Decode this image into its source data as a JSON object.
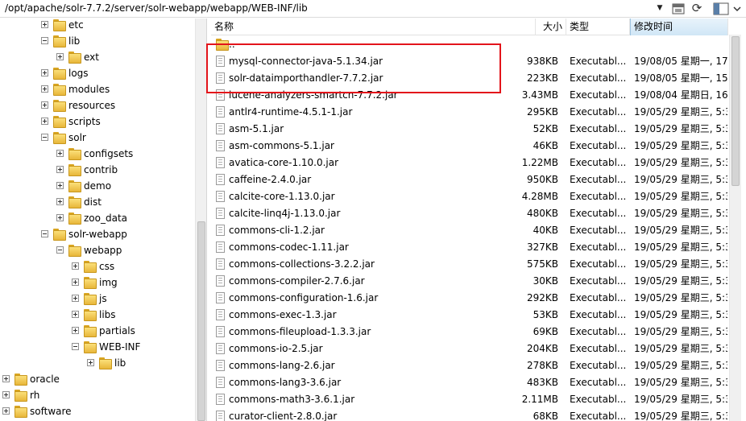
{
  "path": "/opt/apache/solr-7.7.2/server/solr-webapp/webapp/WEB-INF/lib",
  "toolbar": {
    "dropdown_icon": "chevron-down-icon",
    "home_icon": "home-icon",
    "refresh_icon": "refresh-icon",
    "view_icon": "view-toggle-icon"
  },
  "tree": [
    {
      "label": "etc",
      "expander": "plus"
    },
    {
      "label": "lib",
      "expander": "minus"
    },
    {
      "label": "ext",
      "expander": "plus"
    },
    {
      "label": "logs",
      "expander": "plus"
    },
    {
      "label": "modules",
      "expander": "plus"
    },
    {
      "label": "resources",
      "expander": "plus"
    },
    {
      "label": "scripts",
      "expander": "plus"
    },
    {
      "label": "solr",
      "expander": "minus"
    },
    {
      "label": "configsets",
      "expander": "plus"
    },
    {
      "label": "contrib",
      "expander": "plus"
    },
    {
      "label": "demo",
      "expander": "plus"
    },
    {
      "label": "dist",
      "expander": "plus"
    },
    {
      "label": "zoo_data",
      "expander": "plus"
    },
    {
      "label": "solr-webapp",
      "expander": "minus"
    },
    {
      "label": "webapp",
      "expander": "minus"
    },
    {
      "label": "css",
      "expander": "plus"
    },
    {
      "label": "img",
      "expander": "plus"
    },
    {
      "label": "js",
      "expander": "plus"
    },
    {
      "label": "libs",
      "expander": "plus"
    },
    {
      "label": "partials",
      "expander": "plus"
    },
    {
      "label": "WEB-INF",
      "expander": "minus"
    },
    {
      "label": "lib",
      "expander": "plus"
    },
    {
      "label": "oracle",
      "expander": "plus"
    },
    {
      "label": "rh",
      "expander": "plus"
    },
    {
      "label": "software",
      "expander": "plus"
    }
  ],
  "columns": {
    "name": "名称",
    "size": "大小",
    "type": "类型",
    "modified": "修改时间"
  },
  "files": [
    {
      "name": "..",
      "size": "",
      "type": "",
      "modified": "",
      "kind": "folder"
    },
    {
      "name": "mysql-connector-java-5.1.34.jar",
      "size": "938KB",
      "type": "Executabl...",
      "modified": "19/08/05 星期一, 17:",
      "kind": "file"
    },
    {
      "name": "solr-dataimporthandler-7.7.2.jar",
      "size": "223KB",
      "type": "Executabl...",
      "modified": "19/08/05 星期一, 15:",
      "kind": "file"
    },
    {
      "name": "lucene-analyzers-smartcn-7.7.2.jar",
      "size": "3.43MB",
      "type": "Executabl...",
      "modified": "19/08/04 星期日, 16:",
      "kind": "file"
    },
    {
      "name": "antlr4-runtime-4.5.1-1.jar",
      "size": "295KB",
      "type": "Executabl...",
      "modified": "19/05/29 星期三, 5:3",
      "kind": "file"
    },
    {
      "name": "asm-5.1.jar",
      "size": "52KB",
      "type": "Executabl...",
      "modified": "19/05/29 星期三, 5:3",
      "kind": "file"
    },
    {
      "name": "asm-commons-5.1.jar",
      "size": "46KB",
      "type": "Executabl...",
      "modified": "19/05/29 星期三, 5:3",
      "kind": "file"
    },
    {
      "name": "avatica-core-1.10.0.jar",
      "size": "1.22MB",
      "type": "Executabl...",
      "modified": "19/05/29 星期三, 5:3",
      "kind": "file"
    },
    {
      "name": "caffeine-2.4.0.jar",
      "size": "950KB",
      "type": "Executabl...",
      "modified": "19/05/29 星期三, 5:3",
      "kind": "file"
    },
    {
      "name": "calcite-core-1.13.0.jar",
      "size": "4.28MB",
      "type": "Executabl...",
      "modified": "19/05/29 星期三, 5:3",
      "kind": "file"
    },
    {
      "name": "calcite-linq4j-1.13.0.jar",
      "size": "480KB",
      "type": "Executabl...",
      "modified": "19/05/29 星期三, 5:3",
      "kind": "file"
    },
    {
      "name": "commons-cli-1.2.jar",
      "size": "40KB",
      "type": "Executabl...",
      "modified": "19/05/29 星期三, 5:3",
      "kind": "file"
    },
    {
      "name": "commons-codec-1.11.jar",
      "size": "327KB",
      "type": "Executabl...",
      "modified": "19/05/29 星期三, 5:3",
      "kind": "file"
    },
    {
      "name": "commons-collections-3.2.2.jar",
      "size": "575KB",
      "type": "Executabl...",
      "modified": "19/05/29 星期三, 5:3",
      "kind": "file"
    },
    {
      "name": "commons-compiler-2.7.6.jar",
      "size": "30KB",
      "type": "Executabl...",
      "modified": "19/05/29 星期三, 5:3",
      "kind": "file"
    },
    {
      "name": "commons-configuration-1.6.jar",
      "size": "292KB",
      "type": "Executabl...",
      "modified": "19/05/29 星期三, 5:3",
      "kind": "file"
    },
    {
      "name": "commons-exec-1.3.jar",
      "size": "53KB",
      "type": "Executabl...",
      "modified": "19/05/29 星期三, 5:3",
      "kind": "file"
    },
    {
      "name": "commons-fileupload-1.3.3.jar",
      "size": "69KB",
      "type": "Executabl...",
      "modified": "19/05/29 星期三, 5:3",
      "kind": "file"
    },
    {
      "name": "commons-io-2.5.jar",
      "size": "204KB",
      "type": "Executabl...",
      "modified": "19/05/29 星期三, 5:3",
      "kind": "file"
    },
    {
      "name": "commons-lang-2.6.jar",
      "size": "278KB",
      "type": "Executabl...",
      "modified": "19/05/29 星期三, 5:3",
      "kind": "file"
    },
    {
      "name": "commons-lang3-3.6.jar",
      "size": "483KB",
      "type": "Executabl...",
      "modified": "19/05/29 星期三, 5:3",
      "kind": "file"
    },
    {
      "name": "commons-math3-3.6.1.jar",
      "size": "2.11MB",
      "type": "Executabl...",
      "modified": "19/05/29 星期三, 5:3",
      "kind": "file"
    },
    {
      "name": "curator-client-2.8.0.jar",
      "size": "68KB",
      "type": "Executabl...",
      "modified": "19/05/29 星期三, 5:3",
      "kind": "file"
    }
  ]
}
